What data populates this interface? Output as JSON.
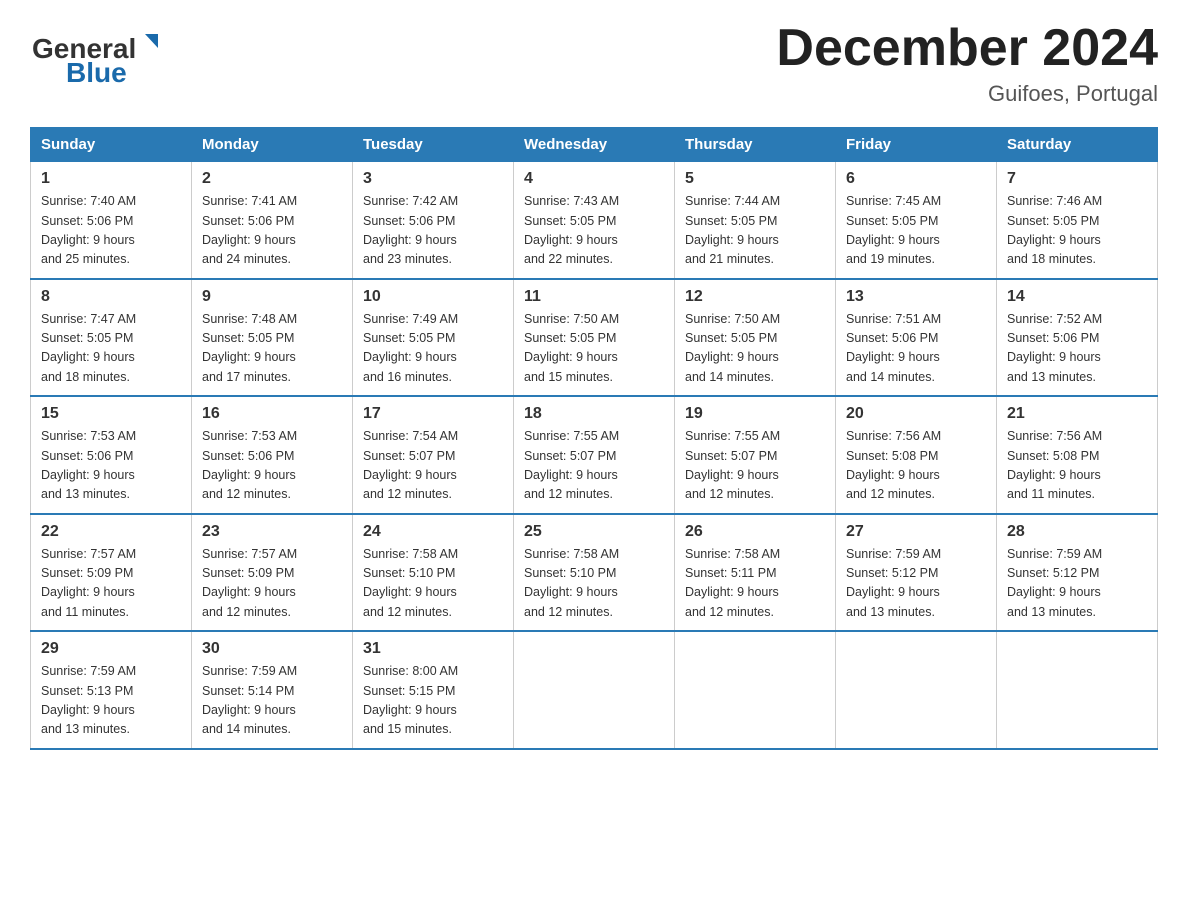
{
  "header": {
    "logo_general": "General",
    "logo_blue": "Blue",
    "month_title": "December 2024",
    "location": "Guifoes, Portugal"
  },
  "weekdays": [
    "Sunday",
    "Monday",
    "Tuesday",
    "Wednesday",
    "Thursday",
    "Friday",
    "Saturday"
  ],
  "weeks": [
    [
      {
        "day": "1",
        "sunrise": "7:40 AM",
        "sunset": "5:06 PM",
        "daylight": "9 hours and 25 minutes."
      },
      {
        "day": "2",
        "sunrise": "7:41 AM",
        "sunset": "5:06 PM",
        "daylight": "9 hours and 24 minutes."
      },
      {
        "day": "3",
        "sunrise": "7:42 AM",
        "sunset": "5:06 PM",
        "daylight": "9 hours and 23 minutes."
      },
      {
        "day": "4",
        "sunrise": "7:43 AM",
        "sunset": "5:05 PM",
        "daylight": "9 hours and 22 minutes."
      },
      {
        "day": "5",
        "sunrise": "7:44 AM",
        "sunset": "5:05 PM",
        "daylight": "9 hours and 21 minutes."
      },
      {
        "day": "6",
        "sunrise": "7:45 AM",
        "sunset": "5:05 PM",
        "daylight": "9 hours and 19 minutes."
      },
      {
        "day": "7",
        "sunrise": "7:46 AM",
        "sunset": "5:05 PM",
        "daylight": "9 hours and 18 minutes."
      }
    ],
    [
      {
        "day": "8",
        "sunrise": "7:47 AM",
        "sunset": "5:05 PM",
        "daylight": "9 hours and 18 minutes."
      },
      {
        "day": "9",
        "sunrise": "7:48 AM",
        "sunset": "5:05 PM",
        "daylight": "9 hours and 17 minutes."
      },
      {
        "day": "10",
        "sunrise": "7:49 AM",
        "sunset": "5:05 PM",
        "daylight": "9 hours and 16 minutes."
      },
      {
        "day": "11",
        "sunrise": "7:50 AM",
        "sunset": "5:05 PM",
        "daylight": "9 hours and 15 minutes."
      },
      {
        "day": "12",
        "sunrise": "7:50 AM",
        "sunset": "5:05 PM",
        "daylight": "9 hours and 14 minutes."
      },
      {
        "day": "13",
        "sunrise": "7:51 AM",
        "sunset": "5:06 PM",
        "daylight": "9 hours and 14 minutes."
      },
      {
        "day": "14",
        "sunrise": "7:52 AM",
        "sunset": "5:06 PM",
        "daylight": "9 hours and 13 minutes."
      }
    ],
    [
      {
        "day": "15",
        "sunrise": "7:53 AM",
        "sunset": "5:06 PM",
        "daylight": "9 hours and 13 minutes."
      },
      {
        "day": "16",
        "sunrise": "7:53 AM",
        "sunset": "5:06 PM",
        "daylight": "9 hours and 12 minutes."
      },
      {
        "day": "17",
        "sunrise": "7:54 AM",
        "sunset": "5:07 PM",
        "daylight": "9 hours and 12 minutes."
      },
      {
        "day": "18",
        "sunrise": "7:55 AM",
        "sunset": "5:07 PM",
        "daylight": "9 hours and 12 minutes."
      },
      {
        "day": "19",
        "sunrise": "7:55 AM",
        "sunset": "5:07 PM",
        "daylight": "9 hours and 12 minutes."
      },
      {
        "day": "20",
        "sunrise": "7:56 AM",
        "sunset": "5:08 PM",
        "daylight": "9 hours and 12 minutes."
      },
      {
        "day": "21",
        "sunrise": "7:56 AM",
        "sunset": "5:08 PM",
        "daylight": "9 hours and 11 minutes."
      }
    ],
    [
      {
        "day": "22",
        "sunrise": "7:57 AM",
        "sunset": "5:09 PM",
        "daylight": "9 hours and 11 minutes."
      },
      {
        "day": "23",
        "sunrise": "7:57 AM",
        "sunset": "5:09 PM",
        "daylight": "9 hours and 12 minutes."
      },
      {
        "day": "24",
        "sunrise": "7:58 AM",
        "sunset": "5:10 PM",
        "daylight": "9 hours and 12 minutes."
      },
      {
        "day": "25",
        "sunrise": "7:58 AM",
        "sunset": "5:10 PM",
        "daylight": "9 hours and 12 minutes."
      },
      {
        "day": "26",
        "sunrise": "7:58 AM",
        "sunset": "5:11 PM",
        "daylight": "9 hours and 12 minutes."
      },
      {
        "day": "27",
        "sunrise": "7:59 AM",
        "sunset": "5:12 PM",
        "daylight": "9 hours and 13 minutes."
      },
      {
        "day": "28",
        "sunrise": "7:59 AM",
        "sunset": "5:12 PM",
        "daylight": "9 hours and 13 minutes."
      }
    ],
    [
      {
        "day": "29",
        "sunrise": "7:59 AM",
        "sunset": "5:13 PM",
        "daylight": "9 hours and 13 minutes."
      },
      {
        "day": "30",
        "sunrise": "7:59 AM",
        "sunset": "5:14 PM",
        "daylight": "9 hours and 14 minutes."
      },
      {
        "day": "31",
        "sunrise": "8:00 AM",
        "sunset": "5:15 PM",
        "daylight": "9 hours and 15 minutes."
      },
      null,
      null,
      null,
      null
    ]
  ],
  "labels": {
    "sunrise": "Sunrise:",
    "sunset": "Sunset:",
    "daylight": "Daylight:"
  }
}
